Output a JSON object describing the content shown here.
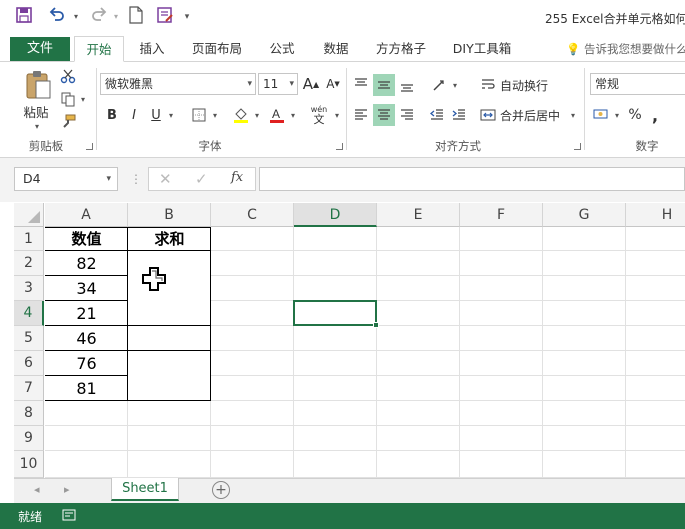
{
  "title_bar": {
    "document_title": "255 Excel合并单元格如何"
  },
  "ribbon_tabs": [
    "文件",
    "开始",
    "插入",
    "页面布局",
    "公式",
    "数据",
    "方方格子",
    "DIY工具箱"
  ],
  "tell_me": "告诉我您想要做什么",
  "ribbon": {
    "clipboard": {
      "paste": "粘贴",
      "label": "剪贴板"
    },
    "font": {
      "name": "微软雅黑",
      "size": "11",
      "grow": "A",
      "shrink": "A",
      "bold": "B",
      "italic": "I",
      "underline": "U",
      "label": "字体",
      "wen": "wén",
      "wen_char": "文"
    },
    "alignment": {
      "wrap": "自动换行",
      "merge": "合并后居中",
      "label": "对齐方式"
    },
    "number": {
      "format": "常规",
      "percent": "%",
      "comma": ",",
      "label": "数字"
    }
  },
  "formula_bar": {
    "name_box": "D4",
    "fx": "fx"
  },
  "columns": [
    "A",
    "B",
    "C",
    "D",
    "E",
    "F",
    "G",
    "H"
  ],
  "selected_column": "D",
  "rows": [
    "1",
    "2",
    "3",
    "4",
    "5",
    "6",
    "7",
    "8",
    "9",
    "10"
  ],
  "selected_row": "4",
  "headers": {
    "a1": "数值",
    "b1": "求和"
  },
  "values": [
    "82",
    "34",
    "21",
    "46",
    "76",
    "81"
  ],
  "sheet_tab": "Sheet1",
  "status": "就绪",
  "colors": {
    "accent": "#217346"
  }
}
